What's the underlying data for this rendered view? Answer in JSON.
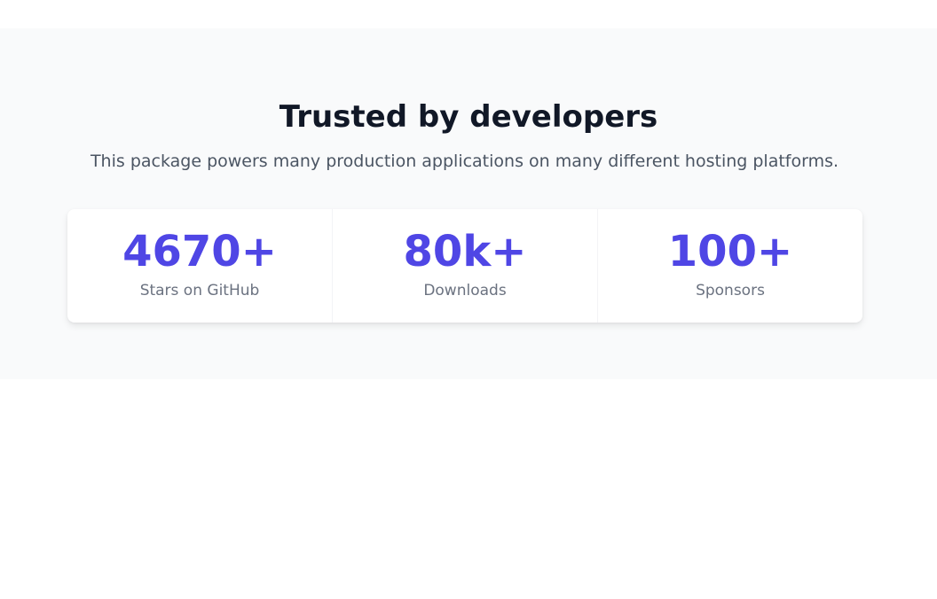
{
  "section": {
    "title": "Trusted by developers",
    "description": "This package powers many production applications on many different hosting platforms."
  },
  "stats": [
    {
      "value": "4670+",
      "label": "Stars on GitHub"
    },
    {
      "value": "80k+",
      "label": "Downloads"
    },
    {
      "value": "100+",
      "label": "Sponsors"
    }
  ],
  "colors": {
    "accent": "#4f46e5",
    "heading": "#111827",
    "text": "#4b5563",
    "muted": "#6b7280",
    "section_bg": "#f9fafb"
  }
}
